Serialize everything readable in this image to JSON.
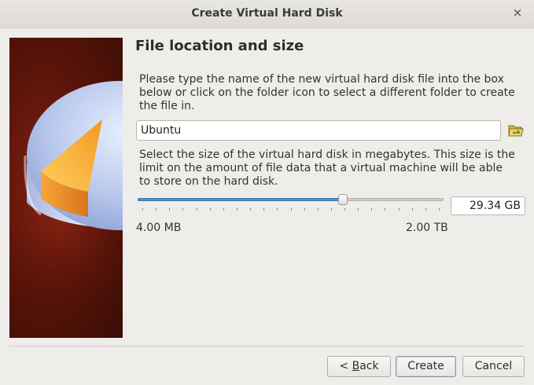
{
  "window": {
    "title": "Create Virtual Hard Disk",
    "close_icon": "×"
  },
  "page": {
    "heading": "File location and size",
    "location_text": "Please type the name of the new virtual hard disk file into the box below or click on the folder icon to select a different folder to create the file in.",
    "file_name": "Ubuntu",
    "size_text": "Select the size of the virtual hard disk in megabytes. This size is the limit on the amount of file data that a virtual machine will be able to store on the hard disk.",
    "size_value": "29.34 GB",
    "slider_fraction": 0.67,
    "min_label": "4.00 MB",
    "max_label": "2.00 TB"
  },
  "buttons": {
    "back_prefix": "< ",
    "back_mnemonic": "B",
    "back_rest": "ack",
    "create": "Create",
    "cancel": "Cancel"
  },
  "icons": {
    "folder": "folder-open-icon",
    "close": "close-icon"
  },
  "colors": {
    "accent": "#4a8fc7",
    "banner": "#5a1409"
  }
}
